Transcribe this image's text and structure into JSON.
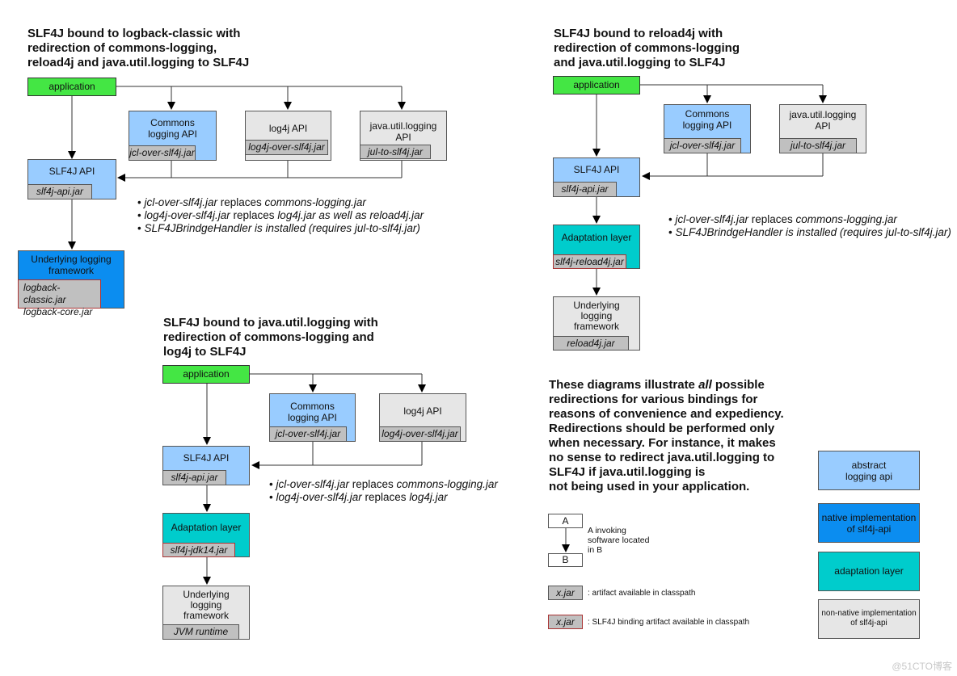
{
  "diagram1": {
    "title_lines": [
      "SLF4J bound to logback-classic with",
      "redirection of commons-logging,",
      "reload4j and java.util.logging to SLF4J"
    ],
    "application": "application",
    "commons": {
      "lines": [
        "Commons",
        "logging API"
      ],
      "jar": "jcl-over-slf4j.jar"
    },
    "log4j": {
      "lines": [
        "log4j API"
      ],
      "jar": "log4j-over-slf4j.jar"
    },
    "jul": {
      "lines": [
        "java.util.logging",
        "API"
      ],
      "jar": "jul-to-slf4j.jar"
    },
    "slf4j": {
      "lines": [
        "SLF4J API"
      ],
      "jar": "slf4j-api.jar"
    },
    "underlying": {
      "lines": [
        "Underlying logging",
        "framework"
      ],
      "jars": [
        "logback-classic.jar",
        "logback-core.jar"
      ]
    },
    "bullets": [
      {
        "i1": "jcl-over-slf4j.jar",
        "n": " replaces ",
        "i2": "commons-logging.jar"
      },
      {
        "i1": "log4j-over-slf4j.jar",
        "n": " replaces ",
        "i2": "log4j.jar as well as reload4j.jar"
      },
      {
        "i1": "SLF4JBrindgeHandler is installed (requires jul-to-slf4j.jar)",
        "n": "",
        "i2": ""
      }
    ]
  },
  "diagram2": {
    "title_lines": [
      "SLF4J bound to reload4j with",
      "redirection of commons-logging",
      "and java.util.logging to SLF4J"
    ],
    "application": "application",
    "commons": {
      "lines": [
        "Commons",
        "logging API"
      ],
      "jar": "jcl-over-slf4j.jar"
    },
    "jul": {
      "lines": [
        "java.util.logging",
        "API"
      ],
      "jar": "jul-to-slf4j.jar"
    },
    "slf4j": {
      "lines": [
        "SLF4J API"
      ],
      "jar": "slf4j-api.jar"
    },
    "adaptation": {
      "lines": [
        "Adaptation layer"
      ],
      "jar": "slf4j-reload4j.jar"
    },
    "underlying": {
      "lines": [
        "Underlying",
        "logging",
        "framework"
      ],
      "jar": "reload4j.jar"
    },
    "bullets": [
      {
        "i1": "jcl-over-slf4j.jar",
        "n": " replaces ",
        "i2": "commons-logging.jar"
      },
      {
        "i1": "SLF4JBrindgeHandler is installed (requires jul-to-slf4j.jar)",
        "n": "",
        "i2": ""
      }
    ]
  },
  "diagram3": {
    "title_lines": [
      "SLF4J bound to java.util.logging with",
      "redirection of commons-logging and",
      "log4j to SLF4J"
    ],
    "application": "application",
    "commons": {
      "lines": [
        "Commons",
        "logging API"
      ],
      "jar": "jcl-over-slf4j.jar"
    },
    "log4j": {
      "lines": [
        "log4j API"
      ],
      "jar": "log4j-over-slf4j.jar"
    },
    "slf4j": {
      "lines": [
        "SLF4J API"
      ],
      "jar": "slf4j-api.jar"
    },
    "adaptation": {
      "lines": [
        "Adaptation layer"
      ],
      "jar": "slf4j-jdk14.jar"
    },
    "underlying": {
      "lines": [
        "Underlying",
        "logging",
        "framework"
      ],
      "jar": "JVM runtime"
    },
    "bullets": [
      {
        "i1": "jcl-over-slf4j.jar",
        "n": " replaces ",
        "i2": "commons-logging.jar"
      },
      {
        "i1": "log4j-over-slf4j.jar",
        "n": " replaces ",
        "i2": "log4j.jar"
      }
    ]
  },
  "note": {
    "pre": "These diagrams illustrate ",
    "em": "all",
    "post": " possible redirections for various bindings for reasons of convenience and expediency. Redirections should be performed only when necessary. For instance, it makes no sense to redirect java.util.logging to SLF4J if java.util.logging is not being used in your application.",
    "lines": [
      [
        "These diagrams illustrate ",
        "all",
        " possible"
      ],
      [
        "redirections for various bindings for"
      ],
      [
        "reasons of convenience and expediency."
      ],
      [
        "Redirections should be performed only"
      ],
      [
        "when necessary. For instance, it makes"
      ],
      [
        "no sense to redirect java.util.logging to"
      ],
      [
        "SLF4J if java.util.logging is"
      ],
      [
        "not being used in your application."
      ]
    ]
  },
  "legend": {
    "a": "A",
    "b": "B",
    "invoke_lines": [
      "A invoking",
      "software located",
      "in B"
    ],
    "jar_label": "x.jar",
    "jar_desc": ": artifact available in classpath",
    "binding_jar_label": "x.jar",
    "binding_desc": ": SLF4J binding artifact available in classpath",
    "colors": [
      {
        "lines": [
          "abstract",
          "logging api"
        ],
        "color": "#99ccff"
      },
      {
        "lines": [
          "native implementation",
          "of slf4j-api"
        ],
        "color": "#0b8df0"
      },
      {
        "lines": [
          "adaptation layer"
        ],
        "color": "#00cccc"
      },
      {
        "lines": [
          "non-native implementation",
          "of slf4j-api"
        ],
        "color": "#e6e6e6"
      }
    ]
  },
  "watermark": "@51CTO博客"
}
